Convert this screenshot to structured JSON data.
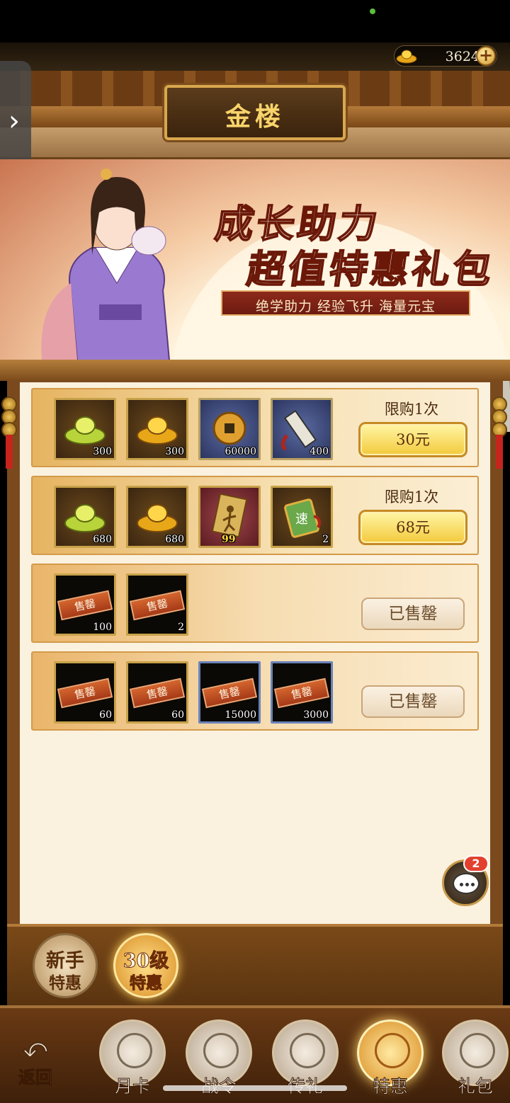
{
  "currency": {
    "amount": "3624",
    "icon": "gold-ingot-icon"
  },
  "header": {
    "title": "金楼"
  },
  "banner": {
    "title_line1": "成长助力",
    "title_line2": "超值特惠礼包",
    "subtitle": "绝学助力 经验飞升 海量元宝"
  },
  "packs": [
    {
      "limit": "限购1次",
      "price": "30元",
      "status": "available",
      "items": [
        {
          "icon": "green-gold-ingot-icon",
          "qty": "300",
          "frame": "gold"
        },
        {
          "icon": "gold-ingot-icon",
          "qty": "300",
          "frame": "gold"
        },
        {
          "icon": "copper-coin-icon",
          "qty": "60000",
          "frame": "blue"
        },
        {
          "icon": "scroll-icon",
          "qty": "400",
          "frame": "blue"
        }
      ]
    },
    {
      "limit": "限购1次",
      "price": "68元",
      "status": "available",
      "items": [
        {
          "icon": "green-gold-ingot-icon",
          "qty": "680",
          "frame": "gold"
        },
        {
          "icon": "gold-ingot-icon",
          "qty": "680",
          "frame": "gold"
        },
        {
          "icon": "martial-art-card-icon",
          "qty": "99",
          "frame": "red"
        },
        {
          "icon": "speed-token-icon",
          "qty": "2",
          "frame": "gold"
        }
      ]
    },
    {
      "status": "sold_out",
      "sold_label": "已售罄",
      "items": [
        {
          "icon": "sold-out-item-icon",
          "qty": "100",
          "tag": "售罄"
        },
        {
          "icon": "sold-out-item-icon",
          "qty": "2",
          "tag": "售罄"
        }
      ]
    },
    {
      "status": "sold_out",
      "sold_label": "已售罄",
      "items": [
        {
          "icon": "sold-out-item-icon",
          "qty": "60",
          "tag": "售罄"
        },
        {
          "icon": "sold-out-item-icon",
          "qty": "60",
          "tag": "售罄"
        },
        {
          "icon": "sold-out-item-icon",
          "qty": "15000",
          "tag": "售罄"
        },
        {
          "icon": "sold-out-item-icon",
          "qty": "3000",
          "tag": "售罄"
        }
      ]
    }
  ],
  "chat": {
    "badge": "2"
  },
  "subtabs": [
    {
      "line1": "新手",
      "line2": "特惠",
      "active": false
    },
    {
      "line1": "30级",
      "line2": "特惠",
      "active": true
    }
  ],
  "bottom_nav": {
    "back_label": "返回",
    "items": [
      {
        "label": "月卡",
        "icon": "month-card-icon",
        "active": false
      },
      {
        "label": "战令",
        "icon": "battle-pass-icon",
        "active": false
      },
      {
        "label": "传礼",
        "icon": "gift-transfer-icon",
        "active": false
      },
      {
        "label": "特惠",
        "icon": "special-offer-icon",
        "active": true
      },
      {
        "label": "礼包",
        "icon": "gift-pack-icon",
        "active": false
      }
    ]
  }
}
